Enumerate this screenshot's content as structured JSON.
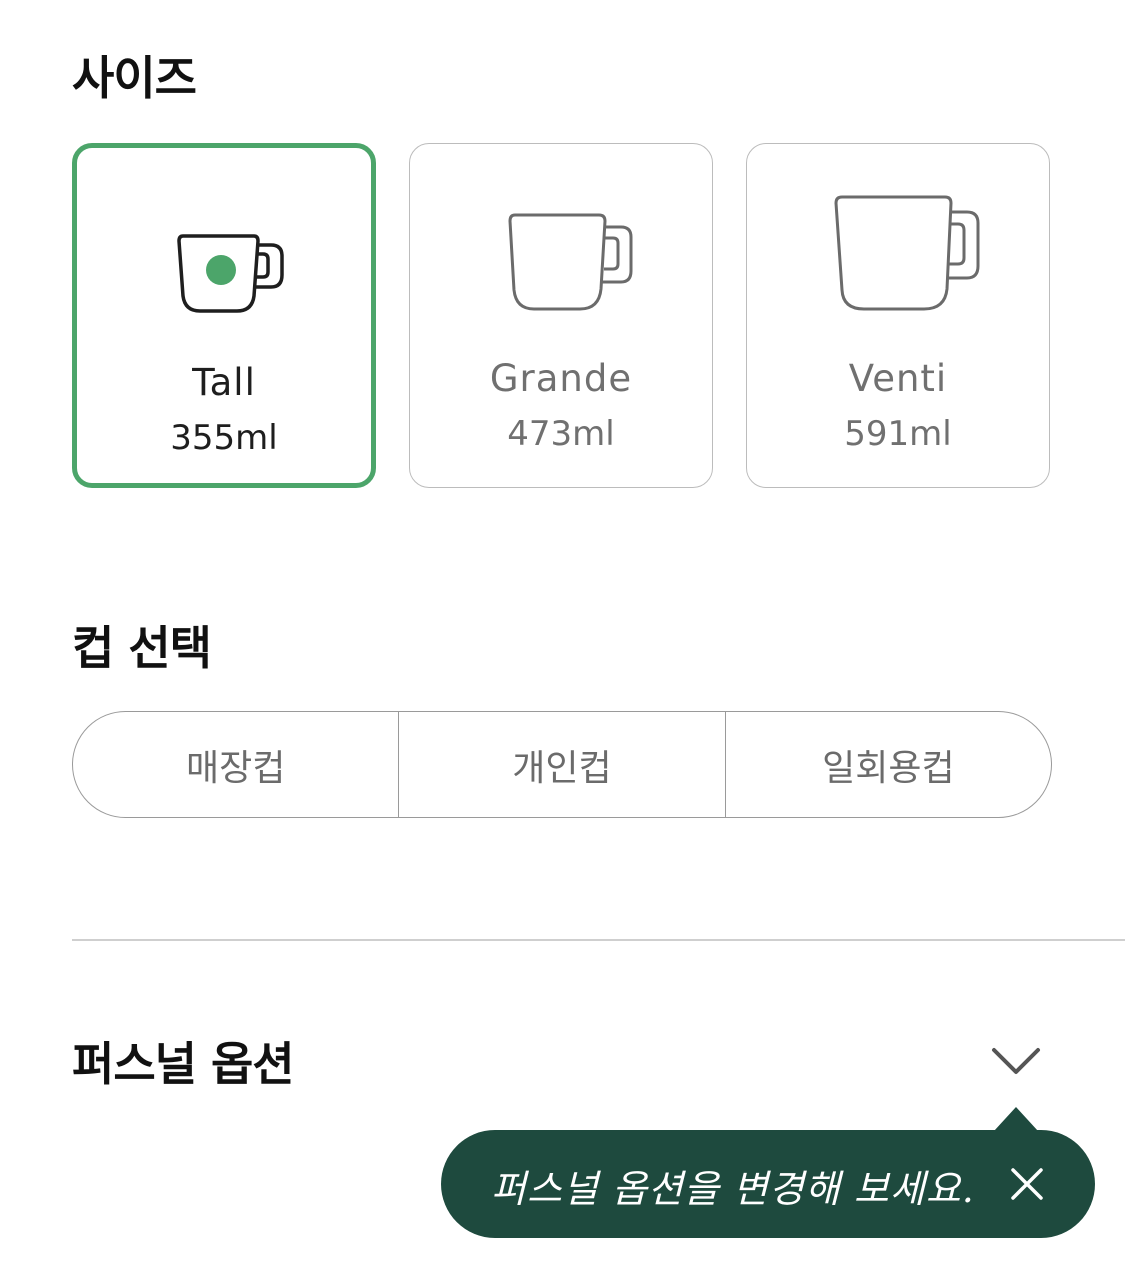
{
  "size_section": {
    "title": "사이즈",
    "options": [
      {
        "name": "Tall",
        "volume": "355ml",
        "selected": true,
        "icon": "mug-small-icon"
      },
      {
        "name": "Grande",
        "volume": "473ml",
        "selected": false,
        "icon": "mug-medium-icon"
      },
      {
        "name": "Venti",
        "volume": "591ml",
        "selected": false,
        "icon": "mug-large-icon"
      }
    ]
  },
  "cup_section": {
    "title": "컵 선택",
    "options": [
      "매장컵",
      "개인컵",
      "일회용컵"
    ]
  },
  "personal_option": {
    "title": "퍼스널 옵션",
    "chevron_icon": "chevron-down-icon"
  },
  "tooltip": {
    "text": "퍼스널 옵션을 변경해 보세요.",
    "close_icon": "close-icon"
  },
  "colors": {
    "accent_green": "#4ca56a",
    "tooltip_bg": "#1e4a3e",
    "border_gray": "#bcbcbc"
  }
}
